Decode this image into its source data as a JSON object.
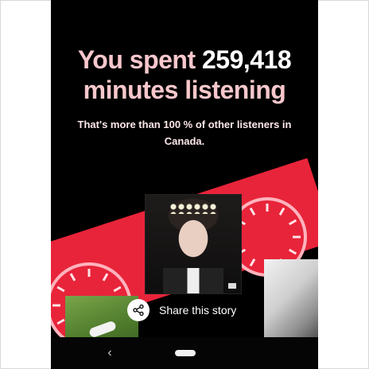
{
  "story": {
    "headline_prefix": "You spent ",
    "headline_number": "259,418",
    "headline_suffix": "minutes listening",
    "subtext": "That's more than 100 % of other listeners in Canada."
  },
  "share": {
    "label": "Share this story",
    "icon": "share-icon"
  },
  "system_nav": {
    "back_glyph": "‹"
  },
  "colors": {
    "background": "#000000",
    "headline_pink": "#f7c7cc",
    "accent_red": "#e8243a"
  }
}
